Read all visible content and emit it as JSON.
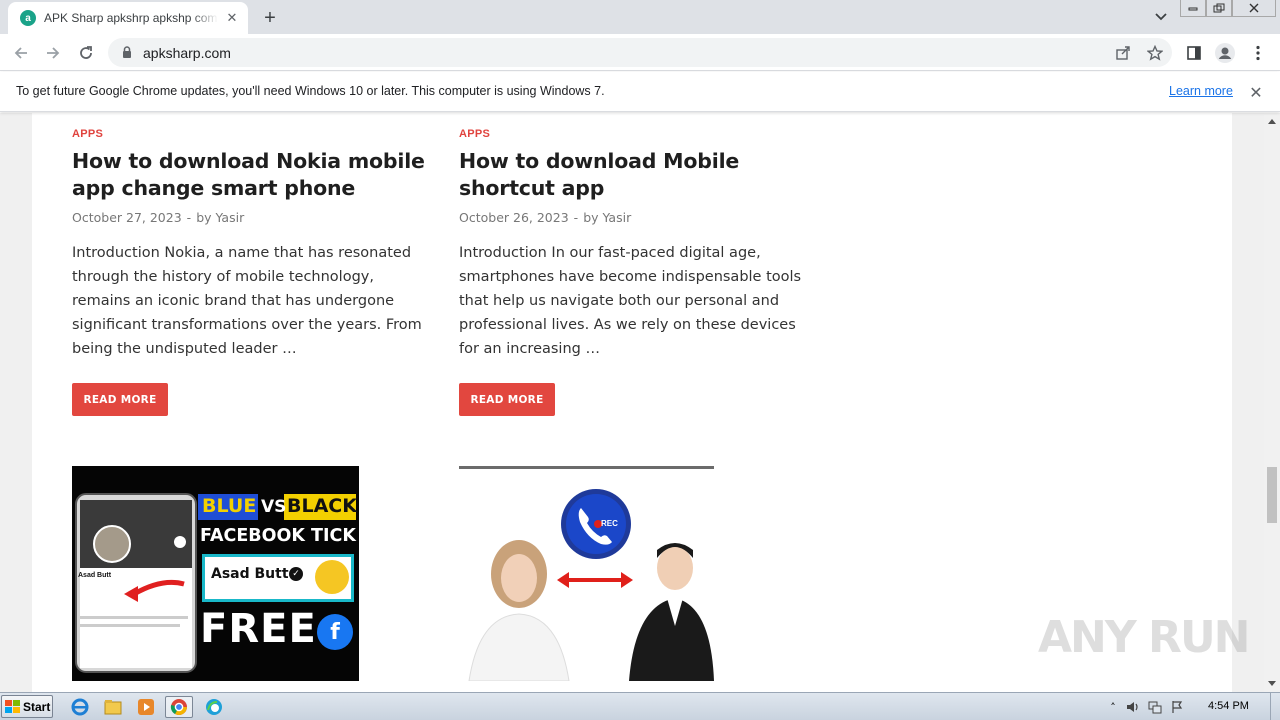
{
  "browser": {
    "tab": {
      "title": "APK Sharp apkshrp apkshp com - Yo",
      "favicon_letter": "a",
      "favicon_color": "#1aa389"
    },
    "new_tab_icon": "plus-icon",
    "address": {
      "url": "apksharp.com"
    },
    "infobar": {
      "message": "To get future Google Chrome updates, you'll need Windows 10 or later. This computer is using Windows 7.",
      "link": "Learn more"
    }
  },
  "posts": [
    {
      "category": "APPS",
      "title": "How to download Nokia mobile app change smart phone",
      "date": "October 27, 2023",
      "by": "by",
      "author": "Yasir",
      "excerpt": "Introduction Nokia, a name that has resonated through the history of mobile technology, remains an iconic brand that has undergone significant transformations over the years. From being the undisputed leader …",
      "button": "READ MORE"
    },
    {
      "category": "APPS",
      "title": "How to download Mobile shortcut app",
      "date": "October 26, 2023",
      "by": "by",
      "author": "Yasir",
      "excerpt": "Introduction In our fast-paced digital age, smartphones have become indispensable tools that help us navigate both our personal and professional lives. As we rely on these devices for an increasing …",
      "button": "READ MORE"
    }
  ],
  "thumbnails": {
    "fb": {
      "blue": "BLUE",
      "vs": "VS",
      "black": "BLACK",
      "headline": "FACEBOOK TICK",
      "name": "Asad Butt",
      "free": "FREE",
      "fb_letter": "f",
      "small_name": "Asad Butt"
    },
    "call": {
      "rec": "REC"
    }
  },
  "watermark": "ANY RUN",
  "taskbar": {
    "start": "Start",
    "clock": "4:54 PM"
  },
  "colors": {
    "accent": "#e2473f",
    "category": "#e0433e",
    "link": "#1a73e8"
  }
}
